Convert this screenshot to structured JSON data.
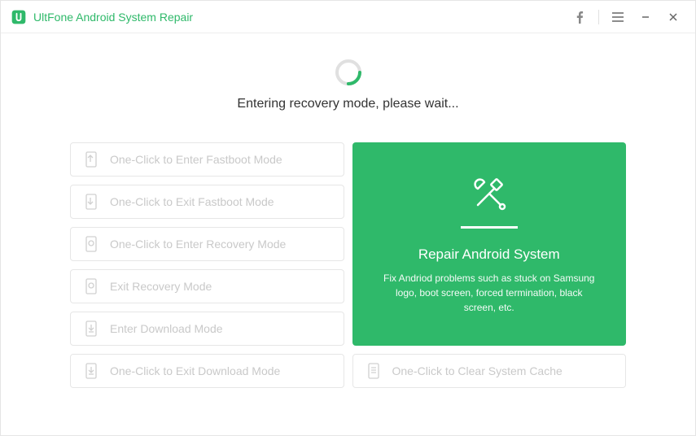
{
  "app": {
    "title": "UltFone Android System Repair"
  },
  "status": {
    "text": "Entering recovery mode, please wait..."
  },
  "options": {
    "enter_fastboot": "One-Click to Enter Fastboot Mode",
    "exit_fastboot": "One-Click to Exit Fastboot Mode",
    "enter_recovery": "One-Click to Enter Recovery Mode",
    "exit_recovery": "Exit Recovery Mode",
    "enter_download": "Enter Download Mode",
    "exit_download": "One-Click to Exit Download Mode",
    "clear_cache": "One-Click to Clear System Cache"
  },
  "repair": {
    "title": "Repair Android System",
    "description": "Fix Andriod problems such as stuck on Samsung logo, boot screen, forced termination, black screen, etc."
  },
  "colors": {
    "accent": "#2fb96a"
  }
}
